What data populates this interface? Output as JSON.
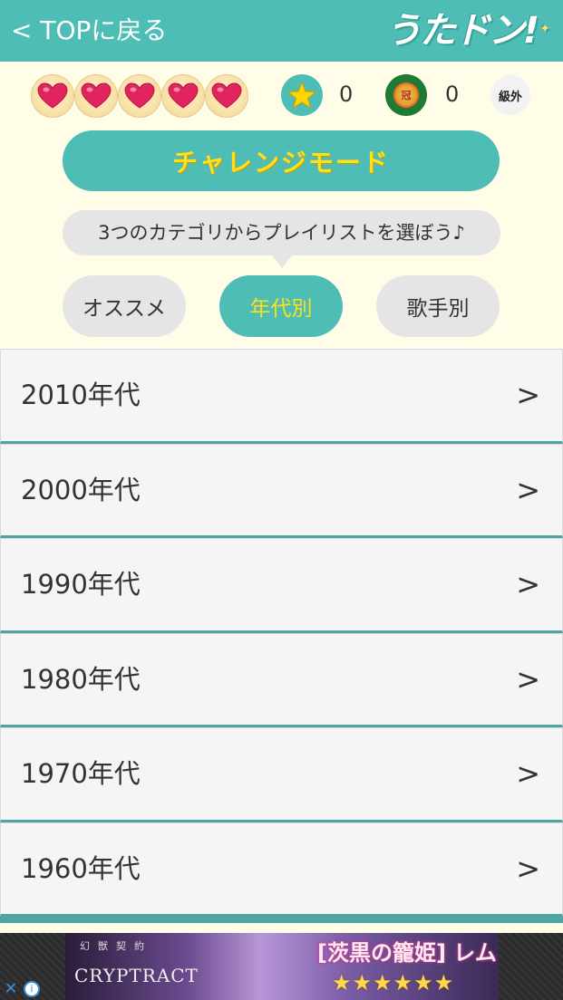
{
  "header": {
    "back_label": "< TOPに戻る",
    "logo_text": "うたドン!"
  },
  "status": {
    "hearts": 5,
    "star_count": "0",
    "medal_count": "0",
    "rank_label": "級外",
    "medal_glyph": "冠"
  },
  "challenge_button": {
    "label": "チャレンジモード"
  },
  "tooltip": {
    "text": "3つのカテゴリからプレイリストを選ぼう♪"
  },
  "tabs": [
    {
      "label": "オススメ",
      "active": false
    },
    {
      "label": "年代別",
      "active": true
    },
    {
      "label": "歌手別",
      "active": false
    }
  ],
  "era_list": [
    {
      "label": "2010年代",
      "chevron": ">"
    },
    {
      "label": "2000年代",
      "chevron": ">"
    },
    {
      "label": "1990年代",
      "chevron": ">"
    },
    {
      "label": "1980年代",
      "chevron": ">"
    },
    {
      "label": "1970年代",
      "chevron": ">"
    },
    {
      "label": "1960年代",
      "chevron": ">"
    }
  ],
  "ad": {
    "logo": "CRYPTRACT",
    "logo_sub": "幻獣契約",
    "title": "[茨黒の籠姫] レム",
    "stars": "★★★★★★",
    "close": "✕",
    "info": "i"
  },
  "colors": {
    "accent": "#4dbdb5",
    "highlight_text": "#ffe01a",
    "background": "#fffde8",
    "heart": "#e0245e"
  }
}
